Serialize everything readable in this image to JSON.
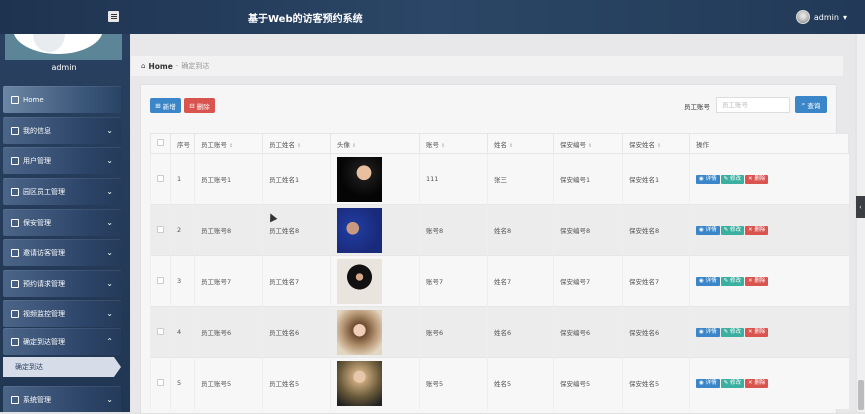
{
  "header": {
    "title": "基于Web的访客预约系统",
    "user": "admin",
    "user_caret": "▾"
  },
  "sidebar": {
    "username": "admin",
    "items": [
      {
        "label": "Home",
        "icon": "home-icon"
      },
      {
        "label": "我的信息",
        "icon": "card-icon"
      },
      {
        "label": "用户管理",
        "icon": "grid-icon"
      },
      {
        "label": "园区员工管理",
        "icon": "grid-icon"
      },
      {
        "label": "保安管理",
        "icon": "user-icon"
      },
      {
        "label": "邀请访客管理",
        "icon": "list-icon"
      },
      {
        "label": "预约请求管理",
        "icon": "pin-icon"
      },
      {
        "label": "视频监控管理",
        "icon": "briefcase-icon"
      },
      {
        "label": "确定到达管理",
        "icon": "monitor-icon"
      },
      {
        "label": "系统管理",
        "icon": "grid-icon"
      }
    ],
    "active_sub": "确定到达"
  },
  "breadcrumb": {
    "home": "Home",
    "sep": "-",
    "current": "确定到达"
  },
  "toolbar": {
    "add_label": "新增",
    "delete_label": "删除",
    "search_label": "员工账号",
    "search_placeholder": "员工账号",
    "search_button": "查询"
  },
  "table": {
    "headers": [
      "序号",
      "员工账号",
      "员工姓名",
      "头像",
      "账号",
      "姓名",
      "保安编号",
      "保安姓名",
      "操作"
    ],
    "rows": [
      {
        "no": "1",
        "emp_account": "员工账号1",
        "emp_name": "员工姓名1",
        "account": "111",
        "name": "张三",
        "guard_no": "保安编号1",
        "guard_name": "保安姓名1"
      },
      {
        "no": "2",
        "emp_account": "员工账号8",
        "emp_name": "员工姓名8",
        "account": "账号8",
        "name": "姓名8",
        "guard_no": "保安编号8",
        "guard_name": "保安姓名8"
      },
      {
        "no": "3",
        "emp_account": "员工账号7",
        "emp_name": "员工姓名7",
        "account": "账号7",
        "name": "姓名7",
        "guard_no": "保安编号7",
        "guard_name": "保安姓名7"
      },
      {
        "no": "4",
        "emp_account": "员工账号6",
        "emp_name": "员工姓名6",
        "account": "账号6",
        "name": "姓名6",
        "guard_no": "保安编号6",
        "guard_name": "保安姓名6"
      },
      {
        "no": "5",
        "emp_account": "员工账号5",
        "emp_name": "员工姓名5",
        "account": "账号5",
        "name": "姓名5",
        "guard_no": "保安编号5",
        "guard_name": "保安姓名5"
      }
    ],
    "actions": {
      "view": "详情",
      "edit": "修改",
      "remove": "删除"
    }
  },
  "colors": {
    "header_bg": "#223a58",
    "primary": "#3a86c8",
    "danger": "#d9534f",
    "success": "#3cb0a0"
  }
}
